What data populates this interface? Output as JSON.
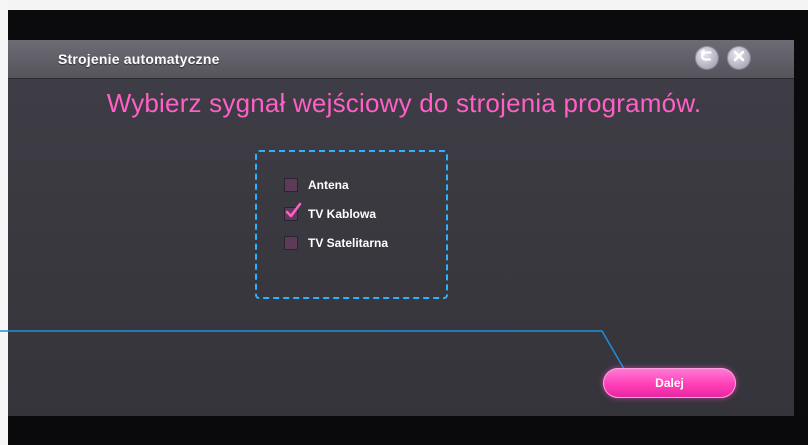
{
  "window": {
    "title": "Strojenie automatyczne"
  },
  "header_buttons": {
    "back_icon": "back-arrow-icon",
    "close_icon": "close-icon"
  },
  "main": {
    "headline": "Wybierz sygnał wejściowy do strojenia programów.",
    "options": [
      {
        "label": "Antena",
        "checked": false
      },
      {
        "label": "TV Kablowa",
        "checked": true
      },
      {
        "label": "TV Satelitarna",
        "checked": false
      }
    ]
  },
  "footer": {
    "next_label": "Dalej"
  },
  "colors": {
    "accent": "#ff3fb7",
    "selection_border": "#2db2ff",
    "headline": "#ff5fc7"
  }
}
